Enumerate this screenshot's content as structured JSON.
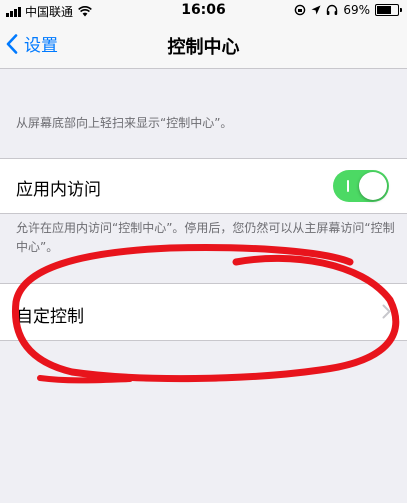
{
  "status_bar": {
    "carrier": "中国联通",
    "time": "16:06",
    "battery_percent": "69%",
    "battery_level": 0.69,
    "icons": [
      "signal-icon",
      "wifi-icon",
      "rotation-lock-icon",
      "location-icon",
      "headphones-icon",
      "battery-icon"
    ]
  },
  "nav": {
    "back_label": "设置",
    "title": "控制中心"
  },
  "main": {
    "note_swipe": "从屏幕底部向上轻扫来显示“控制中心”。",
    "access_within_apps": {
      "label": "应用内访问",
      "toggle_on": true
    },
    "note_access": "允许在应用内访问“控制中心”。停用后，您仍然可以从主屏幕访问“控制中心”。",
    "customize": {
      "label": "自定控制"
    }
  },
  "colors": {
    "accent": "#007aff",
    "toggle_on": "#4cd964",
    "annotation": "#e8141c",
    "background": "#efeff4"
  }
}
